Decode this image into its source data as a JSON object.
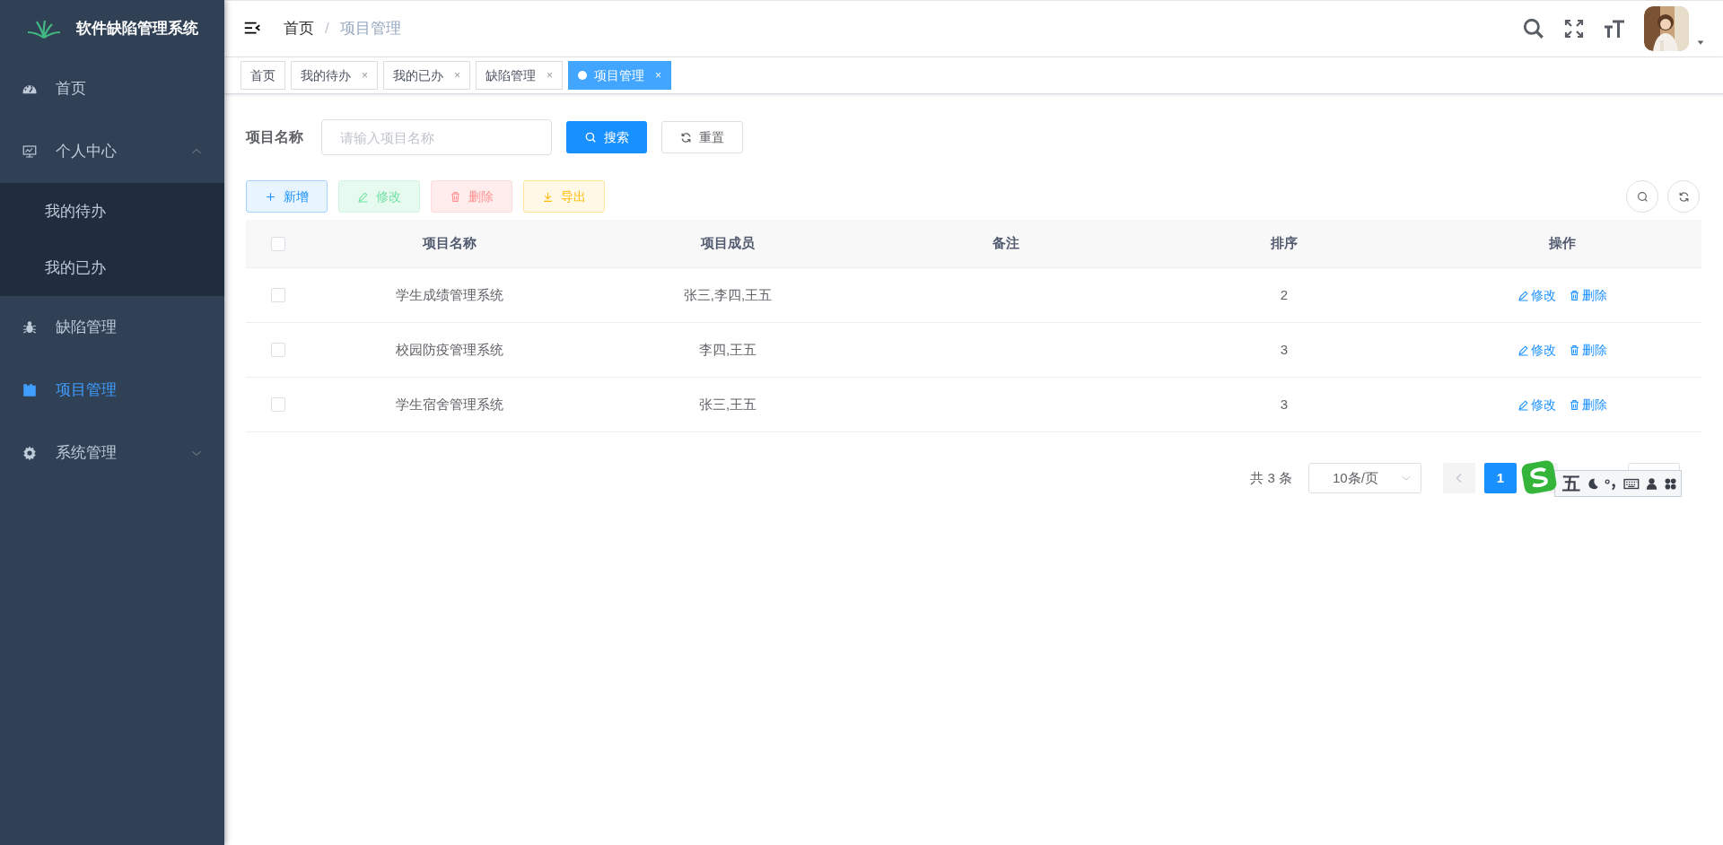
{
  "app": {
    "title": "软件缺陷管理系统"
  },
  "sidebar": {
    "items": [
      {
        "label": "首页",
        "selected": false
      },
      {
        "label": "个人中心",
        "selected": false,
        "expanded": true,
        "children": [
          {
            "label": "我的待办",
            "selected": false
          },
          {
            "label": "我的已办",
            "selected": false
          }
        ]
      },
      {
        "label": "缺陷管理",
        "selected": false
      },
      {
        "label": "项目管理",
        "selected": true
      },
      {
        "label": "系统管理",
        "selected": false,
        "expanded": false
      }
    ]
  },
  "breadcrumb": [
    "首页",
    "项目管理"
  ],
  "breadcrumb_separator": "/",
  "tags": [
    {
      "label": "首页",
      "selected": false,
      "closable": false
    },
    {
      "label": "我的待办",
      "selected": false,
      "closable": true
    },
    {
      "label": "我的已办",
      "selected": false,
      "closable": true
    },
    {
      "label": "缺陷管理",
      "selected": false,
      "closable": true
    },
    {
      "label": "项目管理",
      "selected": true,
      "closable": true
    }
  ],
  "tag_close": "×",
  "search": {
    "label": "项目名称",
    "placeholder": "请输入项目名称",
    "search_button": "搜索",
    "reset_button": "重置"
  },
  "toolbar": [
    {
      "label": "新增",
      "kind": "add",
      "disabled": false
    },
    {
      "label": "修改",
      "kind": "edit",
      "disabled": true
    },
    {
      "label": "删除",
      "kind": "delete",
      "disabled": true
    },
    {
      "label": "导出",
      "kind": "export",
      "disabled": false
    }
  ],
  "table": {
    "all_checked": false,
    "columns": [
      "项目名称",
      "项目成员",
      "备注",
      "排序",
      "操作"
    ],
    "rows": [
      {
        "checked": false,
        "name": "学生成绩管理系统",
        "members": "张三,李四,王五",
        "remark": "",
        "sort": "2",
        "actions": [
          "修改",
          "删除"
        ]
      },
      {
        "checked": false,
        "name": "校园防疫管理系统",
        "members": "李四,王五",
        "remark": "",
        "sort": "3",
        "actions": [
          "修改",
          "删除"
        ]
      },
      {
        "checked": false,
        "name": "学生宿舍管理系统",
        "members": "张三,王五",
        "remark": "",
        "sort": "3",
        "actions": [
          "修改",
          "删除"
        ]
      }
    ]
  },
  "pagination": {
    "total": "共 3 条",
    "page_size": "10条/页",
    "pages": [
      {
        "label": "1",
        "selected": true
      }
    ]
  },
  "ime_toolbar": {
    "mode": "五"
  }
}
